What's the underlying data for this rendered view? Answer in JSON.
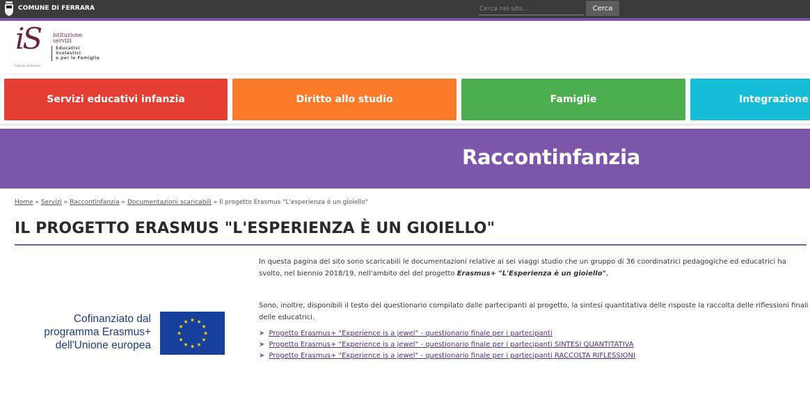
{
  "topbar": {
    "comune_name": "COMUNE DI FERRARA",
    "search_placeholder": "Cerca nel sito...",
    "search_button": "Cerca"
  },
  "logo": {
    "mark": "iS",
    "line1": "istituzione",
    "line2": "servizi",
    "sub1": "Educativi",
    "sub2": "Scolastici",
    "sub3": "e per le Famiglie",
    "footer": "Comune di Ferrara"
  },
  "nav": {
    "items": [
      {
        "label": "Servizi educativi infanzia",
        "color": "#e53f33"
      },
      {
        "label": "Diritto allo studio",
        "color": "#fc7b2b"
      },
      {
        "label": "Famiglie",
        "color": "#4cae4f"
      },
      {
        "label": "Integrazione",
        "color": "#16bdd6"
      }
    ]
  },
  "banner": {
    "title": "Raccontinfanzia",
    "color": "#7c56a9"
  },
  "breadcrumb": {
    "items": [
      "Home",
      "Servizi",
      "Raccontinfanzia",
      "Documentazioni scaricabili"
    ],
    "separator": "»",
    "current": "Il progetto Erasmus \"L'esperienza è un gioiello\""
  },
  "page": {
    "title": "IL PROGETTO ERASMUS \"L'ESPERIENZA È UN GIOIELLO\""
  },
  "erasmus": {
    "line1": "Cofinanziato dal",
    "line2": "programma Erasmus+",
    "line3": "dell'Unione europea"
  },
  "content": {
    "p1_before": "In questa pagina del sito sono scaricabili le documentazioni relative ai sei viaggi studio che un gruppo di 36 coordinatrici pedagogiche ed educatrici ha svolto, nel biennio 2018/19, nell'ambito del del progetto ",
    "p1_bold": "Erasmus+ \"L'Esperienza è un gioiello\"",
    "p1_after": ",",
    "p2": "Sono, inoltre, disponibili il testo del questionario compilato dalle partecipanti al progetto, la sintesi quantitativa delle risposte la raccolta delle riflessioni finali delle educatrici.",
    "bullet": "➤",
    "links": [
      "Progetto Erasmus+ \"Experience is a jewel\" - questionario finale per i partecipanti",
      "Progetto Erasmus+ \"Experience is a jewel\" - questionario finale per i partecipanti SINTESI QUANTITATIVA",
      "Progetto Erasmus+ \"Experience is a jewel\" - questionario finale per i partecipanti RACCOLTA RIFLESSIONI"
    ]
  }
}
